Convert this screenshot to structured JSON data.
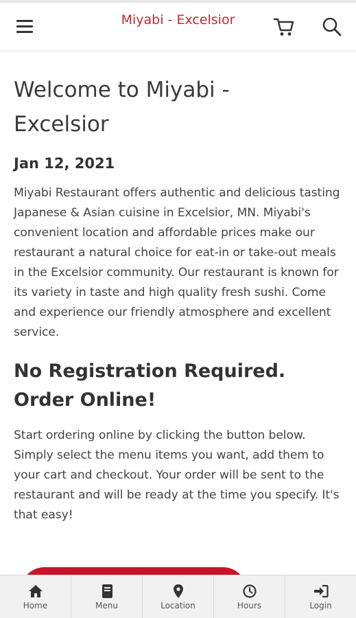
{
  "header": {
    "title": "Miyabi - Excelsior",
    "brand_color": "#c8282e"
  },
  "main": {
    "welcome_heading": "Welcome to Miyabi - Excelsior",
    "date": "Jan 12, 2021",
    "intro_paragraph": "Miyabi Restaurant offers authentic and delicious tasting Japanese & Asian cuisine in Excelsior, MN. Miyabi's convenient location and affordable prices make our restaurant a natural choice for eat-in or take-out meals in the Excelsior community. Our restaurant is known for its variety in taste and high quality fresh sushi. Come and experience our friendly atmosphere and excellent service.",
    "order_heading": "No Registration Required. Order Online!",
    "order_paragraph": "Start ordering online by clicking the button below. Simply select the menu items you want, add them to your cart and checkout. Your order will be sent to the restaurant and will be ready at the time you specify. It's that easy!"
  },
  "bottom_nav": {
    "items": [
      {
        "label": "Home",
        "icon": "home-icon"
      },
      {
        "label": "Menu",
        "icon": "menu-book-icon"
      },
      {
        "label": "Location",
        "icon": "map-pin-icon"
      },
      {
        "label": "Hours",
        "icon": "clock-icon"
      },
      {
        "label": "Login",
        "icon": "login-icon"
      }
    ]
  },
  "colors": {
    "accent": "#c8142a",
    "nav_background": "#f1f1f1"
  }
}
